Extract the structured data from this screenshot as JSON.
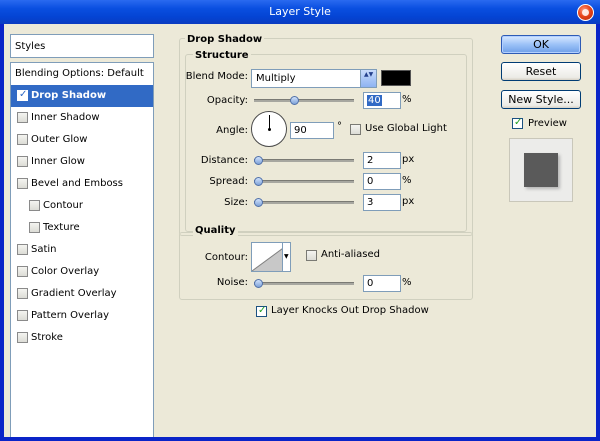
{
  "window": {
    "title": "Layer Style"
  },
  "styles_panel": {
    "header": "Styles",
    "items": [
      {
        "label": "Blending Options: Default",
        "checkbox": false,
        "checked": false,
        "selected": false
      },
      {
        "label": "Drop Shadow",
        "checkbox": true,
        "checked": true,
        "selected": true
      },
      {
        "label": "Inner Shadow",
        "checkbox": true,
        "checked": false,
        "selected": false
      },
      {
        "label": "Outer Glow",
        "checkbox": true,
        "checked": false,
        "selected": false
      },
      {
        "label": "Inner Glow",
        "checkbox": true,
        "checked": false,
        "selected": false
      },
      {
        "label": "Bevel and Emboss",
        "checkbox": true,
        "checked": false,
        "selected": false
      },
      {
        "label": "Contour",
        "checkbox": true,
        "checked": false,
        "selected": false
      },
      {
        "label": "Texture",
        "checkbox": true,
        "checked": false,
        "selected": false
      },
      {
        "label": "Satin",
        "checkbox": true,
        "checked": false,
        "selected": false
      },
      {
        "label": "Color Overlay",
        "checkbox": true,
        "checked": false,
        "selected": false
      },
      {
        "label": "Gradient Overlay",
        "checkbox": true,
        "checked": false,
        "selected": false
      },
      {
        "label": "Pattern Overlay",
        "checkbox": true,
        "checked": false,
        "selected": false
      },
      {
        "label": "Stroke",
        "checkbox": true,
        "checked": false,
        "selected": false
      }
    ]
  },
  "drop_shadow": {
    "section_title": "Drop Shadow",
    "structure": {
      "title": "Structure",
      "blend_mode": {
        "label": "Blend Mode:",
        "value": "Multiply",
        "color": "#000000"
      },
      "opacity": {
        "label": "Opacity:",
        "value": "40",
        "unit": "%",
        "level": 0.4
      },
      "angle": {
        "label": "Angle:",
        "value": "90",
        "unit": "°",
        "global_light_label": "Use Global Light",
        "global_light_checked": false
      },
      "distance": {
        "label": "Distance:",
        "value": "2",
        "unit": "px",
        "level": 0.0
      },
      "spread": {
        "label": "Spread:",
        "value": "0",
        "unit": "%",
        "level": 0.0
      },
      "size": {
        "label": "Size:",
        "value": "3",
        "unit": "px",
        "level": 0.0
      }
    },
    "quality": {
      "title": "Quality",
      "contour_label": "Contour:",
      "anti_aliased_label": "Anti-aliased",
      "anti_aliased_checked": false,
      "noise": {
        "label": "Noise:",
        "value": "0",
        "unit": "%",
        "level": 0.0
      }
    },
    "knockout": {
      "label": "Layer Knocks Out Drop Shadow",
      "checked": true
    }
  },
  "buttons": {
    "ok": "OK",
    "reset": "Reset",
    "new_style": "New Style...",
    "preview_label": "Preview",
    "preview_checked": true
  }
}
